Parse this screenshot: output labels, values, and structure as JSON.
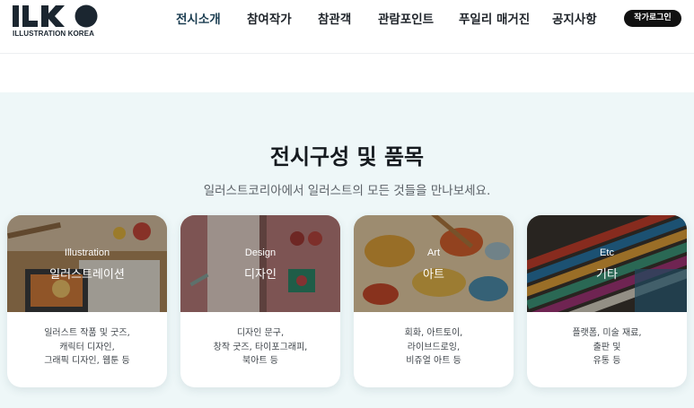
{
  "brand": {
    "logo_text": "ILKO",
    "logo_subtitle": "ILLUSTRATION KOREA",
    "logo_color": "#1b2630"
  },
  "nav": {
    "items": [
      {
        "label": "전시소개",
        "active": true
      },
      {
        "label": "참여작가"
      },
      {
        "label": "참관객"
      },
      {
        "label": "관람포인트"
      },
      {
        "label": "푸일리 매거진"
      },
      {
        "label": "공지사항"
      }
    ],
    "login_label": "작가로그인"
  },
  "section": {
    "title": "전시구성 및 품목",
    "subtitle": "일러스트코리아에서 일러스트의 모든 것들을 만나보세요.",
    "background": "#eef7f8"
  },
  "cards": [
    {
      "en": "Illustration",
      "ko": "일러스트레이션",
      "desc": [
        "일러스트 작품 및 굿즈,",
        "캐릭터 디자인,",
        "그래픽 디자인, 웹툰 등"
      ],
      "image_icon": "illustration-photo"
    },
    {
      "en": "Design",
      "ko": "디자인",
      "desc": [
        "디자인 문구,",
        "창작 굿즈, 타이포그래피,",
        "북아트 등"
      ],
      "image_icon": "design-photo"
    },
    {
      "en": "Art",
      "ko": "아트",
      "desc": [
        "회화, 아트토이,",
        "라이브드로잉,",
        "비쥬얼 아트 등"
      ],
      "image_icon": "art-photo"
    },
    {
      "en": "Etc",
      "ko": "기타",
      "desc": [
        "플랫폼, 미술 재료,",
        "출판 및",
        "유통 등"
      ],
      "image_icon": "brushes-photo"
    }
  ]
}
